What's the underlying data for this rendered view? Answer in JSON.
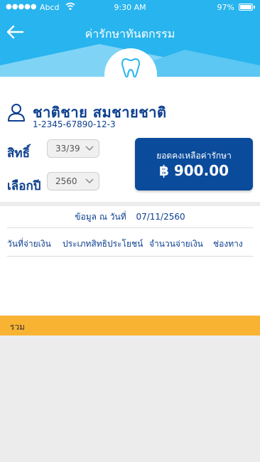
{
  "status_bar": {
    "signal": "●●●●●",
    "carrier": "Abcd",
    "time": "9:30 AM",
    "battery": "97%"
  },
  "header": {
    "title": "ค่ารักษาทันตกรรม"
  },
  "patient": {
    "name": "ชาติชาย   สมชายชาติ",
    "id": "1-2345-67890-12-3"
  },
  "filters": {
    "right_label": "สิทธิ์",
    "right_value": "33/39",
    "year_label": "เลือกปี",
    "year_value": "2560"
  },
  "balance": {
    "label": "ยอดคงเหลือค่ารักษา",
    "amount": "฿ 900.00"
  },
  "info": {
    "as_of_label": "ข้อมูล ณ วันที่",
    "as_of_date": "07/11/2560",
    "columns": [
      "วันที่จ่ายเงิน",
      "ประเภทสิทธิประโยชน์",
      "จำนวนจ่ายเงิน",
      "ช่องทาง"
    ]
  },
  "total": {
    "label": "รวม"
  },
  "colors": {
    "header": "#28b4ee",
    "primary": "#0a4b9b",
    "text": "#0d3f8f",
    "total_bar": "#f9b333"
  }
}
